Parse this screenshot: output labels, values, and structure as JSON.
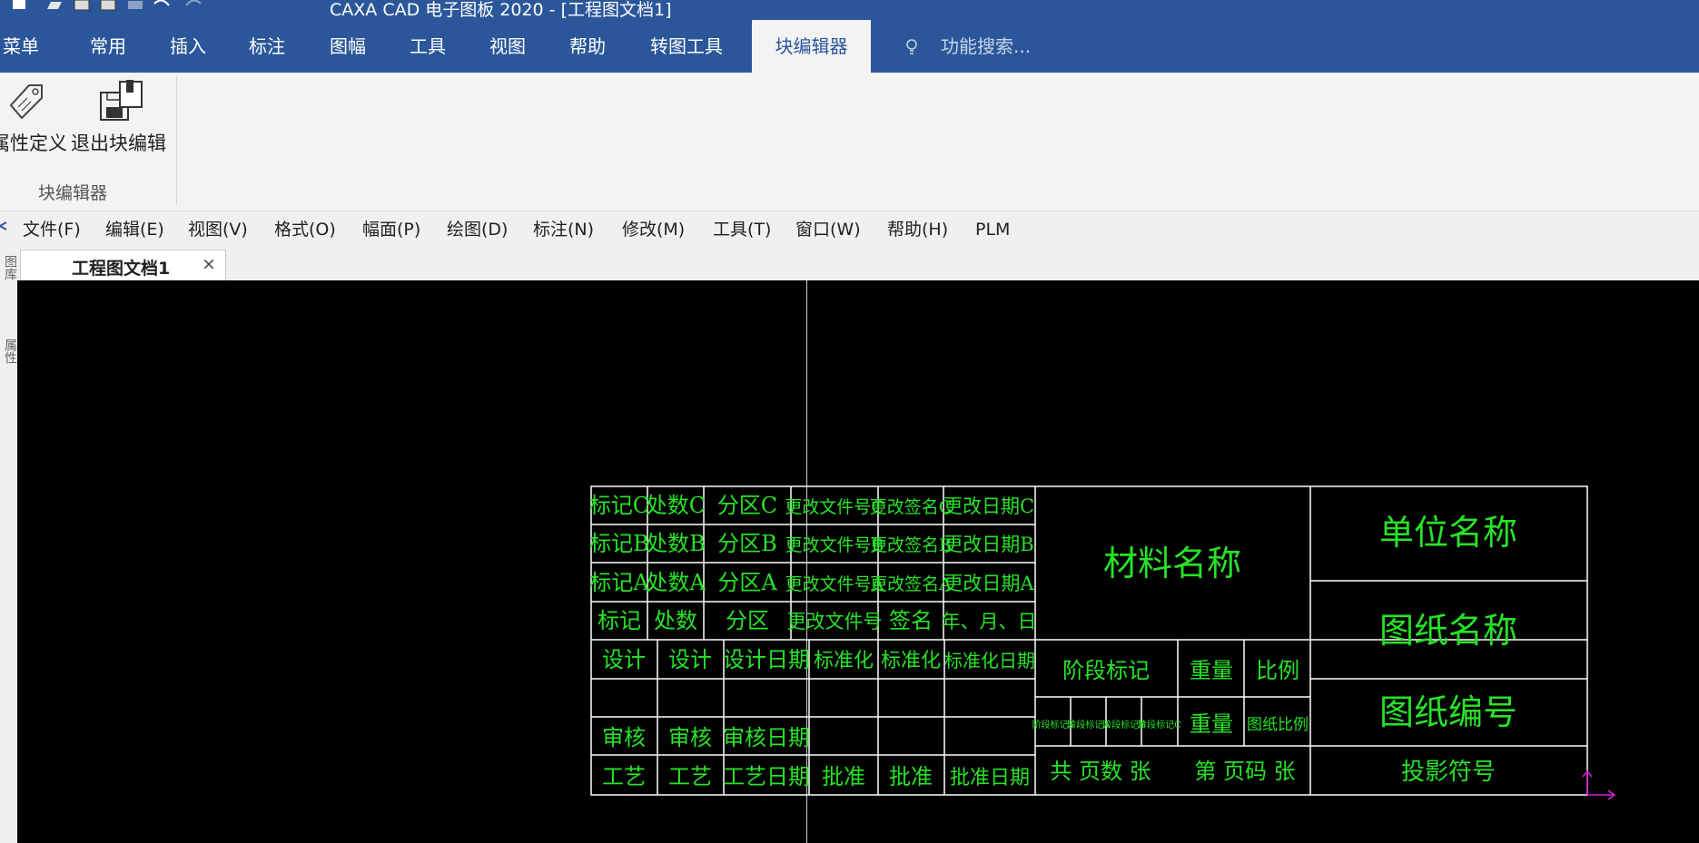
{
  "window": {
    "title": "CAXA CAD 电子图板 2020 - [工程图文档1]"
  },
  "ribbon": {
    "tabs": [
      "菜单",
      "常用",
      "插入",
      "标注",
      "图幅",
      "工具",
      "视图",
      "帮助",
      "转图工具",
      "块编辑器"
    ],
    "active_tab": "块编辑器",
    "search_placeholder": "功能搜索...",
    "buttons": {
      "attr_def": "属性定义",
      "exit_block": "退出块编辑"
    },
    "group_label": "块编辑器"
  },
  "menubar": [
    "文件(F)",
    "编辑(E)",
    "视图(V)",
    "格式(O)",
    "幅面(P)",
    "绘图(D)",
    "标注(N)",
    "修改(M)",
    "工具(T)",
    "窗口(W)",
    "帮助(H)",
    "PLM"
  ],
  "document_tab": {
    "label": "工程图文档1",
    "close": "×"
  },
  "left_panel": {
    "labels": [
      "图库",
      "属性"
    ]
  },
  "title_block": {
    "rev_rows": [
      [
        "标记C",
        "处数C",
        "分区C",
        "更改文件号C",
        "更改签名C",
        "更改日期C"
      ],
      [
        "标记B",
        "处数B",
        "分区B",
        "更改文件号B",
        "更改签名B",
        "更改日期B"
      ],
      [
        "标记A",
        "处数A",
        "分区A",
        "更改文件号A",
        "更改签名A",
        "更改日期A"
      ],
      [
        "标记",
        "处数",
        "分区",
        "更改文件号",
        "签名",
        "年、月、日"
      ]
    ],
    "sign_rows": [
      [
        "设计",
        "设计",
        "设计日期",
        "标准化",
        "标准化",
        "标准化日期"
      ],
      [
        "",
        "",
        "",
        "",
        "",
        ""
      ],
      [
        "审核",
        "审核",
        "审核日期",
        "",
        "",
        ""
      ],
      [
        "工艺",
        "工艺",
        "工艺日期",
        "批准",
        "批准",
        "批准日期"
      ]
    ],
    "material": "材料名称",
    "stage_label": "阶段标记",
    "weight_label": "重量",
    "scale_label": "比例",
    "stage_cells": [
      "阶段标记S",
      "阶段标记A",
      "阶段标记B",
      "阶段标记C"
    ],
    "weight_value": "重量",
    "scale_value": "图纸比例",
    "pages": "共 页数 张",
    "page_no": "第 页码 张",
    "company": "单位名称",
    "drawing_name": "图纸名称",
    "drawing_no": "图纸编号",
    "projection": "投影符号"
  }
}
